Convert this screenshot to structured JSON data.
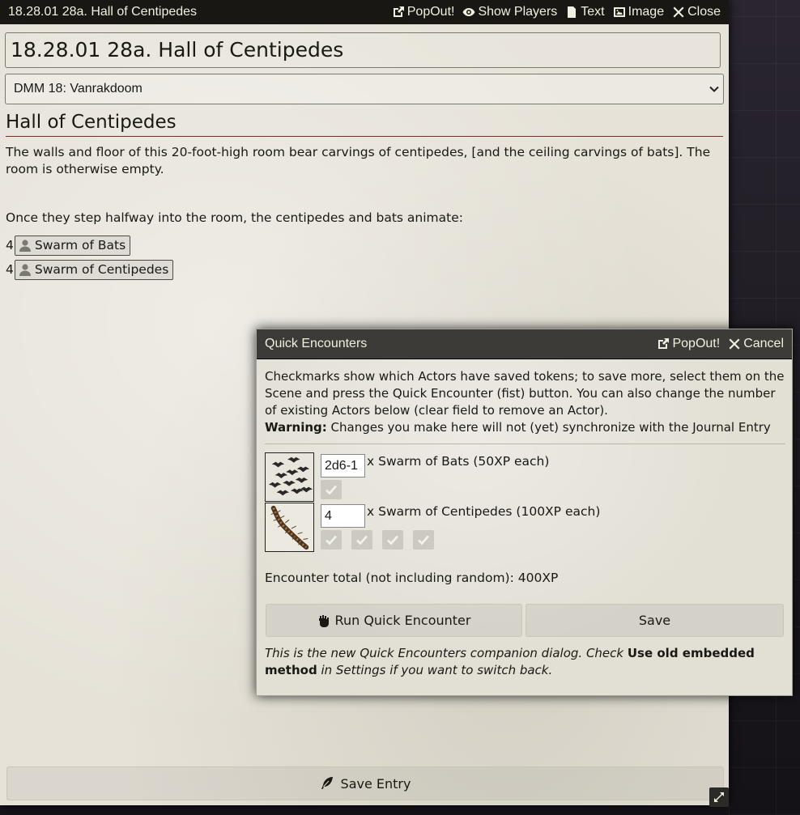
{
  "colors": {
    "header_bg": "#191714",
    "header_text": "#f0f0e0",
    "parchment": "#e6e2d8",
    "heading_rule": "#782e22"
  },
  "journal": {
    "window_title": "18.28.01 28a. Hall of Centipedes",
    "header_buttons": {
      "popout": "PopOut!",
      "show_players": "Show Players",
      "text": "Text",
      "image": "Image",
      "close": "Close"
    },
    "name_value": "18.28.01 28a. Hall of Centipedes",
    "folder_selected": "DMM 18: Vanrakdoom",
    "heading": "Hall of Centipedes",
    "paragraph1": "The walls and floor of this 20-foot-high room bear carvings of centipedes, [and the ceiling carvings of bats]. The room is otherwise empty.",
    "paragraph2": "Once they step halfway into the room, the centipedes and bats animate:",
    "entities": [
      {
        "count": "4",
        "name": "Swarm of Bats",
        "icon": "user-icon"
      },
      {
        "count": "4",
        "name": "Swarm of Centipedes",
        "icon": "user-icon"
      }
    ],
    "save_entry": "Save Entry"
  },
  "quick_encounter": {
    "title": "Quick Encounters",
    "popout": "PopOut!",
    "cancel": "Cancel",
    "description": "Checkmarks show which Actors have saved tokens; to save more, select them on the Scene and press the Quick Encounter (fist) button. You can also change the number of existing Actors below (clear field to remove an Actor).",
    "warning_label": "Warning:",
    "warning_text": " Changes you make here will not (yet) synchronize with the Journal Entry",
    "actors": [
      {
        "number": "2d6-1",
        "label": "x Swarm of Bats (50XP each)",
        "tokens_saved": 1,
        "image": "bats-image"
      },
      {
        "number": "4",
        "label": "x Swarm of Centipedes (100XP each)",
        "tokens_saved": 4,
        "image": "centipede-image"
      }
    ],
    "total": "Encounter total (not including random): 400XP",
    "run_button": "Run Quick Encounter",
    "save_button": "Save",
    "note_prefix": "This is the new Quick Encounters companion dialog. Check ",
    "note_bold": "Use old embedded method",
    "note_suffix": " in Settings if you want to switch back."
  }
}
